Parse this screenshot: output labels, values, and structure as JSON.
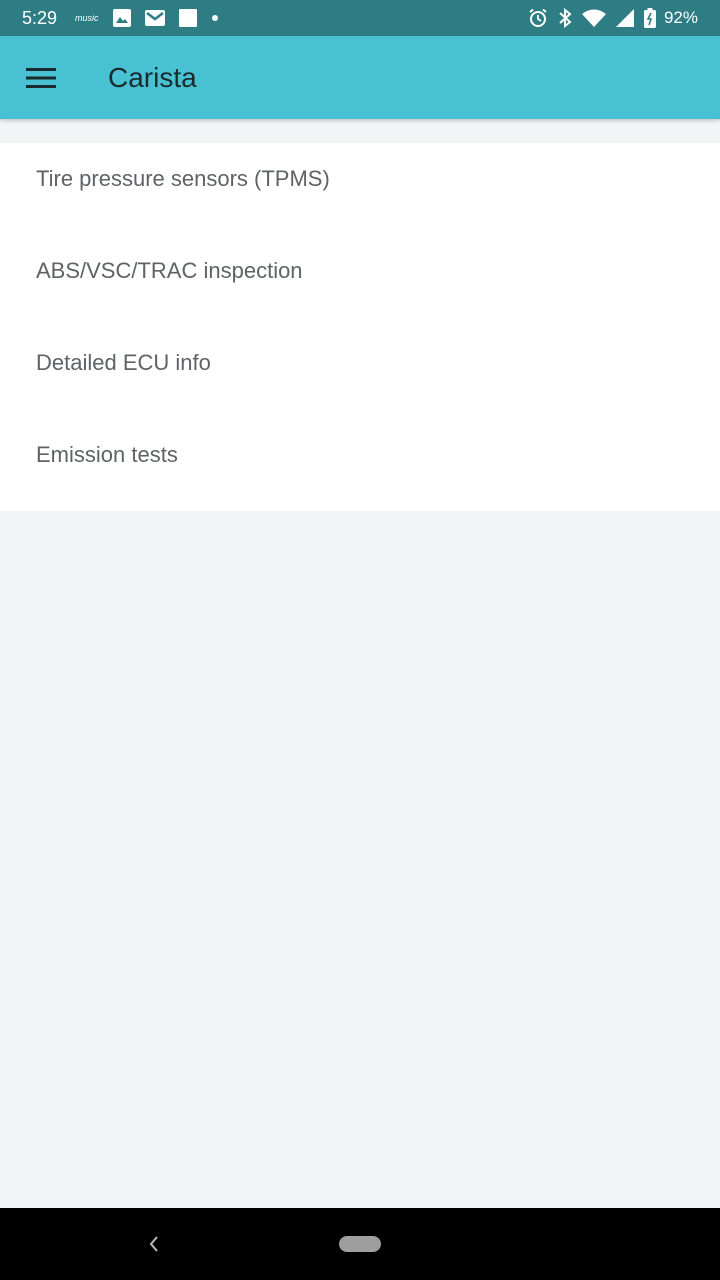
{
  "status_bar": {
    "time": "5:29",
    "music_label": "music",
    "battery_percent": "92%",
    "icons_left": [
      "amazon-music-icon",
      "image-icon",
      "gmail-icon",
      "square-notification-icon",
      "dot-icon"
    ],
    "icons_right": [
      "alarm-icon",
      "bluetooth-icon",
      "wifi-icon",
      "cell-signal-icon",
      "battery-icon"
    ],
    "color": "#2e7d85"
  },
  "app_bar": {
    "title": "Carista",
    "menu_icon": "hamburger-menu-icon",
    "color": "#48c1d2"
  },
  "list": {
    "items": [
      {
        "label": "Tire pressure sensors (TPMS)"
      },
      {
        "label": "ABS/VSC/TRAC inspection"
      },
      {
        "label": "Detailed ECU info"
      },
      {
        "label": "Emission tests"
      }
    ]
  },
  "nav_bar": {
    "back_icon": "back-chevron-icon",
    "home_icon": "home-pill-icon"
  }
}
